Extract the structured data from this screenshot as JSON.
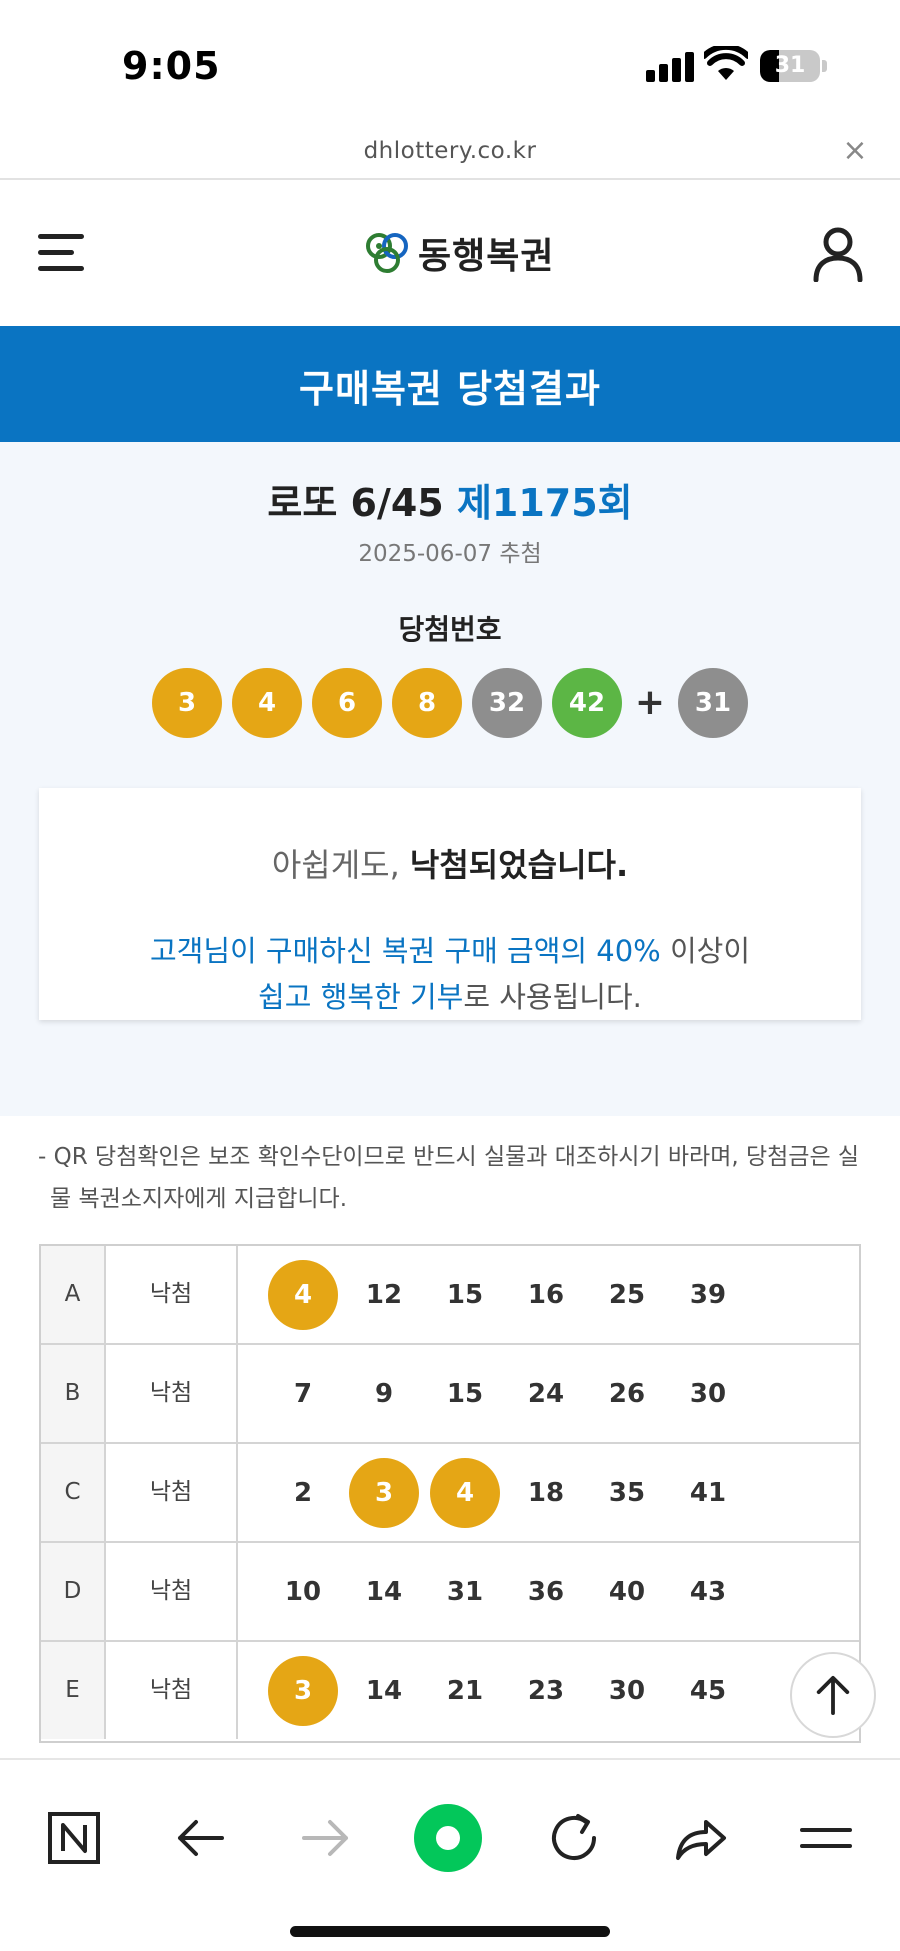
{
  "status": {
    "time": "9:05",
    "battery": "31",
    "battery_level": 0.31
  },
  "browser": {
    "url": "dhlottery.co.kr",
    "close_label": "×"
  },
  "header": {
    "logo_text": "동행복권"
  },
  "banner": {
    "title": "구매복권 당첨결과"
  },
  "result": {
    "game": "로또 6/45",
    "round": "제1175회",
    "date": "2025-06-07 추첨",
    "win_label": "당첨번호",
    "numbers": [
      "3",
      "4",
      "6",
      "8",
      "32",
      "42"
    ],
    "plus": "+",
    "bonus": "31"
  },
  "message": {
    "prefix": "아쉽게도, ",
    "strong": "낙첨되었습니다.",
    "line2_blue": "고객님이 구매하신 복권 구매 금액의 40%",
    "line2_gray": " 이상이",
    "line3_blue": "쉽고 행복한 기부",
    "line3_gray": "로 사용됩니다."
  },
  "note": {
    "line1": "- QR 당첨확인은 보조 확인수단이므로 반드시 실물과 대조하시기 바라며, 당첨금은 실",
    "line2": "물 복권소지자에게 지급합니다."
  },
  "tickets": [
    {
      "slot": "A",
      "result": "낙첨",
      "nums": [
        "4",
        "12",
        "15",
        "16",
        "25",
        "39"
      ],
      "hits": [
        true,
        false,
        false,
        false,
        false,
        false
      ]
    },
    {
      "slot": "B",
      "result": "낙첨",
      "nums": [
        "7",
        "9",
        "15",
        "24",
        "26",
        "30"
      ],
      "hits": [
        false,
        false,
        false,
        false,
        false,
        false
      ]
    },
    {
      "slot": "C",
      "result": "낙첨",
      "nums": [
        "2",
        "3",
        "4",
        "18",
        "35",
        "41"
      ],
      "hits": [
        false,
        true,
        true,
        false,
        false,
        false
      ]
    },
    {
      "slot": "D",
      "result": "낙첨",
      "nums": [
        "10",
        "14",
        "31",
        "36",
        "40",
        "43"
      ],
      "hits": [
        false,
        false,
        false,
        false,
        false,
        false
      ]
    },
    {
      "slot": "E",
      "result": "낙첨",
      "nums": [
        "3",
        "14",
        "21",
        "23",
        "30",
        "45"
      ],
      "hits": [
        true,
        false,
        false,
        false,
        false,
        false
      ]
    }
  ],
  "colors": {
    "brand_blue": "#0a74c2",
    "ball_yellow": "#e5a615",
    "ball_gray": "#8e8e8e",
    "ball_green": "#5cb645",
    "hit_yellow": "#e5a615",
    "naver_green": "#03c75a"
  },
  "icons": {
    "menu": "hamburger-icon",
    "user": "user-icon",
    "scroll_top": "arrow-up-icon",
    "toolbar": [
      "naver-n-icon",
      "back-arrow-icon",
      "forward-arrow-icon",
      "green-dot-icon",
      "refresh-icon",
      "share-icon",
      "menu-lines-icon"
    ]
  }
}
